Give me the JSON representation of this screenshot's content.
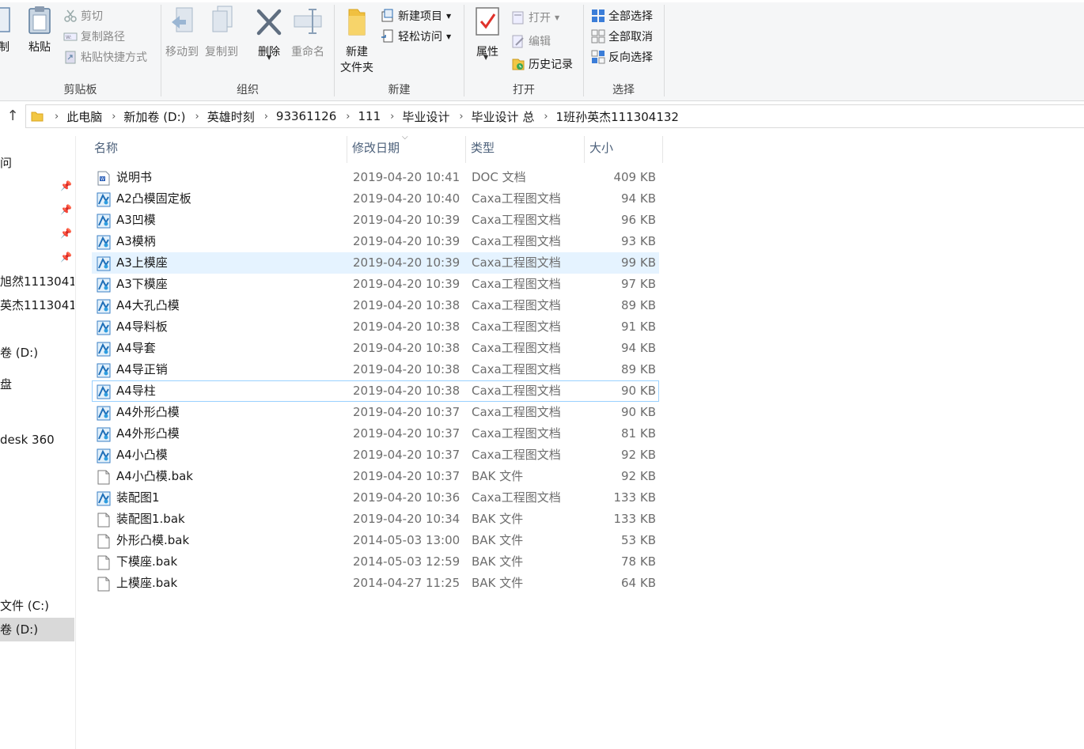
{
  "ribbon": {
    "clipboard": {
      "label": "剪贴板",
      "copy_label": "制",
      "paste_label": "粘贴",
      "cut_label": "剪切",
      "copy_path_label": "复制路径",
      "paste_shortcut_label": "粘贴快捷方式"
    },
    "organize": {
      "label": "组织",
      "move_to_label": "移动到",
      "copy_to_label": "复制到",
      "delete_label": "删除",
      "rename_label": "重命名"
    },
    "new": {
      "label": "新建",
      "new_folder_label_1": "新建",
      "new_folder_label_2": "文件夹",
      "new_item_label": "新建项目",
      "easy_access_label": "轻松访问"
    },
    "open": {
      "label": "打开",
      "properties_label": "属性",
      "open_label": "打开",
      "edit_label": "编辑",
      "history_label": "历史记录"
    },
    "select": {
      "label": "选择",
      "select_all_label": "全部选择",
      "select_none_label": "全部取消",
      "invert_label": "反向选择"
    }
  },
  "breadcrumb": [
    "此电脑",
    "新加卷 (D:)",
    "英雄时刻",
    "93361126",
    "111",
    "毕业设计",
    "毕业设计 总",
    "1班孙英杰111304132"
  ],
  "nav": {
    "items": [
      "问",
      "旭然1113041",
      "英杰1113041",
      "卷 (D:)",
      "盘",
      "desk 360",
      "文件 (C:)",
      "卷 (D:)"
    ]
  },
  "columns": {
    "name": "名称",
    "date": "修改日期",
    "type": "类型",
    "size": "大小"
  },
  "files": [
    {
      "name": "说明书",
      "date": "2019-04-20 10:41",
      "type": "DOC 文档",
      "size": "409 KB",
      "icon": "doc"
    },
    {
      "name": "A2凸模固定板",
      "date": "2019-04-20 10:40",
      "type": "Caxa工程图文档",
      "size": "94 KB",
      "icon": "caxa"
    },
    {
      "name": "A3凹模",
      "date": "2019-04-20 10:39",
      "type": "Caxa工程图文档",
      "size": "96 KB",
      "icon": "caxa"
    },
    {
      "name": "A3模柄",
      "date": "2019-04-20 10:39",
      "type": "Caxa工程图文档",
      "size": "93 KB",
      "icon": "caxa"
    },
    {
      "name": "A3上模座",
      "date": "2019-04-20 10:39",
      "type": "Caxa工程图文档",
      "size": "99 KB",
      "icon": "caxa"
    },
    {
      "name": "A3下模座",
      "date": "2019-04-20 10:39",
      "type": "Caxa工程图文档",
      "size": "97 KB",
      "icon": "caxa"
    },
    {
      "name": "A4大孔凸模",
      "date": "2019-04-20 10:38",
      "type": "Caxa工程图文档",
      "size": "89 KB",
      "icon": "caxa"
    },
    {
      "name": "A4导料板",
      "date": "2019-04-20 10:38",
      "type": "Caxa工程图文档",
      "size": "91 KB",
      "icon": "caxa"
    },
    {
      "name": "A4导套",
      "date": "2019-04-20 10:38",
      "type": "Caxa工程图文档",
      "size": "94 KB",
      "icon": "caxa"
    },
    {
      "name": "A4导正销",
      "date": "2019-04-20 10:38",
      "type": "Caxa工程图文档",
      "size": "89 KB",
      "icon": "caxa"
    },
    {
      "name": "A4导柱",
      "date": "2019-04-20 10:38",
      "type": "Caxa工程图文档",
      "size": "90 KB",
      "icon": "caxa"
    },
    {
      "name": "A4外形凸模",
      "date": "2019-04-20 10:37",
      "type": "Caxa工程图文档",
      "size": "90 KB",
      "icon": "caxa"
    },
    {
      "name": "A4外形凸模",
      "date": "2019-04-20 10:37",
      "type": "Caxa工程图文档",
      "size": "81 KB",
      "icon": "caxa"
    },
    {
      "name": "A4小凸模",
      "date": "2019-04-20 10:37",
      "type": "Caxa工程图文档",
      "size": "92 KB",
      "icon": "caxa"
    },
    {
      "name": "A4小凸模.bak",
      "date": "2019-04-20 10:37",
      "type": "BAK 文件",
      "size": "92 KB",
      "icon": "blank"
    },
    {
      "name": "装配图1",
      "date": "2019-04-20 10:36",
      "type": "Caxa工程图文档",
      "size": "133 KB",
      "icon": "caxa"
    },
    {
      "name": "装配图1.bak",
      "date": "2019-04-20 10:34",
      "type": "BAK 文件",
      "size": "133 KB",
      "icon": "blank"
    },
    {
      "name": "外形凸模.bak",
      "date": "2014-05-03 13:00",
      "type": "BAK 文件",
      "size": "53 KB",
      "icon": "blank"
    },
    {
      "name": "下模座.bak",
      "date": "2014-05-03 12:59",
      "type": "BAK 文件",
      "size": "78 KB",
      "icon": "blank"
    },
    {
      "name": "上模座.bak",
      "date": "2014-04-27 11:25",
      "type": "BAK 文件",
      "size": "64 KB",
      "icon": "blank"
    }
  ]
}
